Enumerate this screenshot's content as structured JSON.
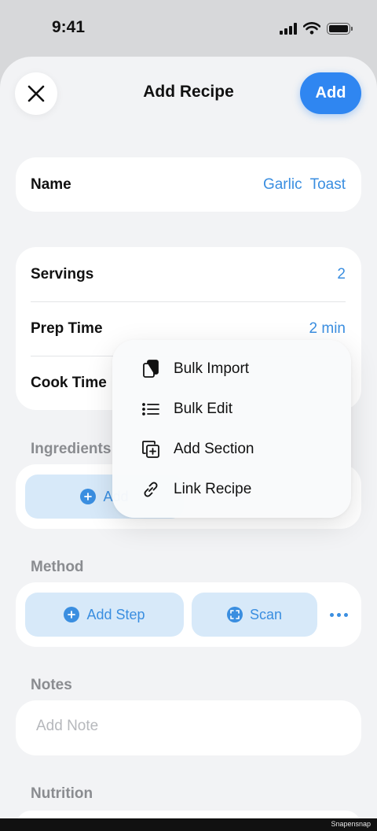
{
  "status_bar": {
    "time": "9:41"
  },
  "nav": {
    "title": "Add Recipe",
    "add_label": "Add"
  },
  "name_row": {
    "label": "Name",
    "value_words": [
      "Garlic",
      "Toast"
    ]
  },
  "details": {
    "servings_label": "Servings",
    "servings_value": "2",
    "prep_label": "Prep Time",
    "prep_value": "2 min",
    "cook_label": "Cook Time"
  },
  "ingredients": {
    "header": "Ingredients",
    "add_label": "Add"
  },
  "method": {
    "header": "Method",
    "add_step_label": "Add Step",
    "scan_label": "Scan"
  },
  "notes": {
    "header": "Notes",
    "placeholder": "Add Note"
  },
  "nutrition": {
    "header": "Nutrition"
  },
  "menu": {
    "items": [
      {
        "label": "Bulk Import",
        "icon": "bulk-import-icon"
      },
      {
        "label": "Bulk Edit",
        "icon": "list-icon"
      },
      {
        "label": "Add Section",
        "icon": "add-section-icon"
      },
      {
        "label": "Link Recipe",
        "icon": "link-icon"
      }
    ]
  },
  "footer": {
    "watermark": "Snapensnap"
  },
  "colors": {
    "accent": "#2f86f1",
    "link": "#3a8ee0",
    "pill_bg": "#d7e9f9",
    "background": "#f2f3f5"
  }
}
